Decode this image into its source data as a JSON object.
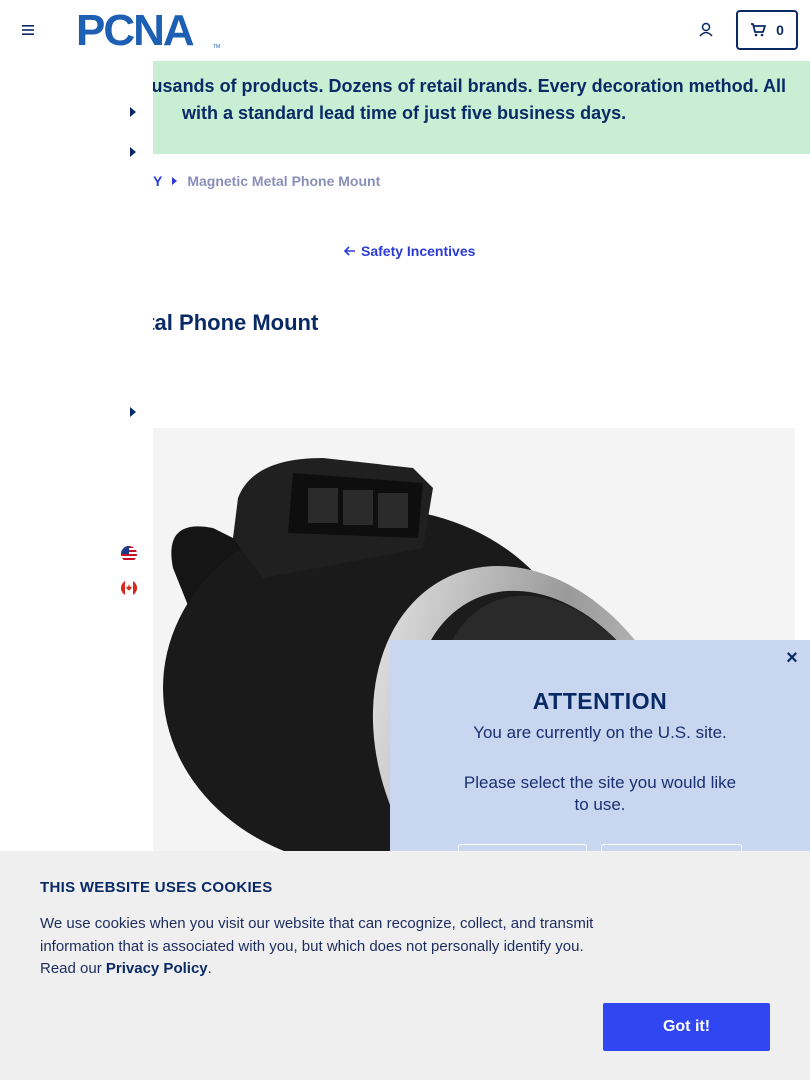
{
  "header": {
    "logo_text": "PCNA",
    "logo_tm": "TM",
    "cart_count": "0"
  },
  "promo": {
    "line1": "usands of products. Dozens of retail brands. Every decoration method. All",
    "line2": "with a standard lead time of just five business days."
  },
  "breadcrumb": {
    "prev": "Y",
    "current": "Magnetic Metal Phone Mount"
  },
  "back_link": {
    "label": "Safety Incentives"
  },
  "product": {
    "title": "etal Phone Mount"
  },
  "attention_modal": {
    "close": "×",
    "title": "ATTENTION",
    "current_site": "You are currently on the U.S. site.",
    "question": "Please select the site you would like to use."
  },
  "cookie_banner": {
    "title": "THIS WEBSITE USES COOKIES",
    "text": "We use cookies when you visit our website that can recognize, collect, and transmit information that is associated with you, but which does not personally identify you. Read our",
    "link": "Privacy Policy",
    "text_end": ".",
    "button": "Got it!"
  },
  "colors": {
    "brand_navy": "#0a2a66",
    "promo_green": "#c8efd3",
    "modal_blue": "#c9d6ef",
    "cta_blue": "#2f46f2",
    "link_blue": "#2b3bd6"
  },
  "icons": [
    "hamburger-icon",
    "account-icon",
    "cart-icon",
    "caret-right-icon",
    "arrow-left-icon",
    "us-flag-icon",
    "canada-flag-icon",
    "close-icon"
  ]
}
